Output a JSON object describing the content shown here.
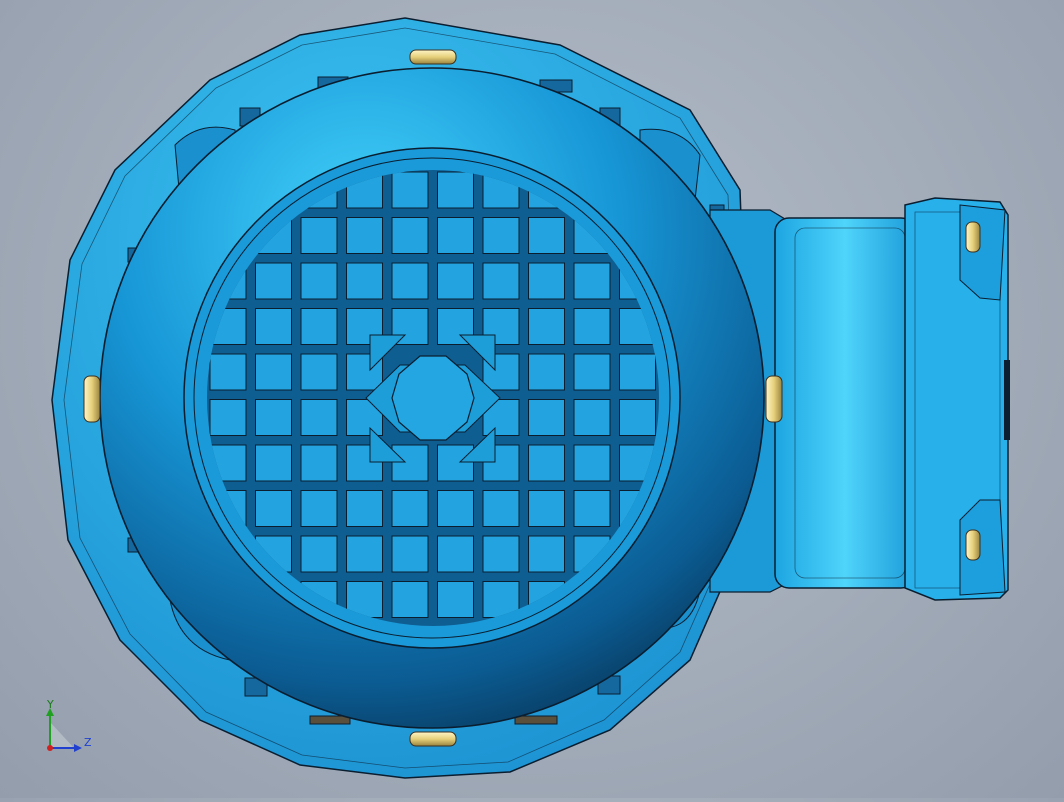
{
  "viewport": {
    "view_name": "CAD model view",
    "colors": {
      "background": "#a7b0bd",
      "part_light": "#3cc8f5",
      "part_mid": "#1c9bd8",
      "part_dark": "#0b3f66",
      "edge": "#0a1e30",
      "screw": "#e8d688"
    }
  },
  "triad": {
    "y_label": "Y",
    "z_label": "Z",
    "colors": {
      "x": "#d02020",
      "y": "#20a020",
      "z": "#2040d0"
    }
  }
}
